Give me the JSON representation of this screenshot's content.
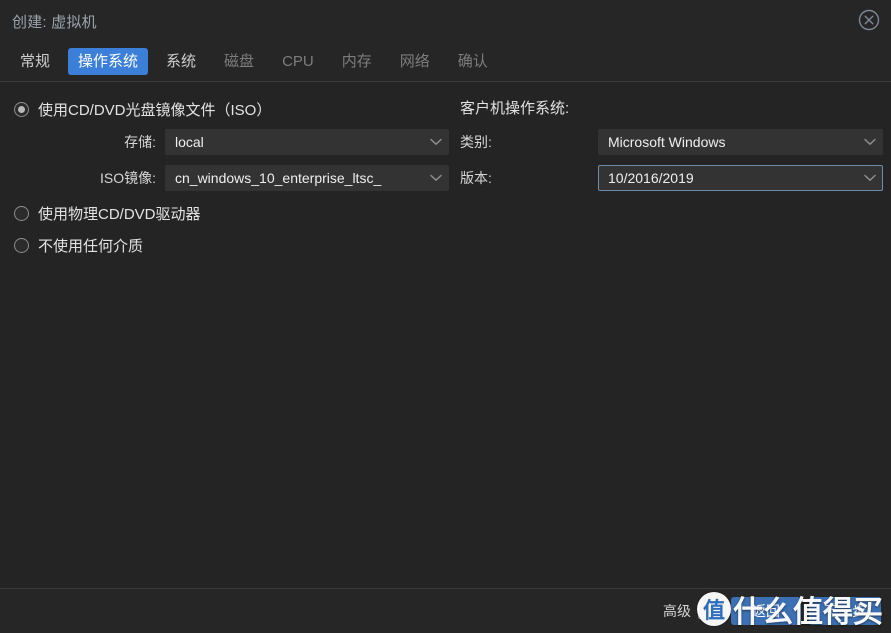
{
  "window": {
    "title": "创建: 虚拟机",
    "close_icon": "close-circle-icon"
  },
  "tabs": [
    {
      "label": "常规",
      "state": "normal"
    },
    {
      "label": "操作系统",
      "state": "active"
    },
    {
      "label": "系统",
      "state": "normal"
    },
    {
      "label": "磁盘",
      "state": "dim"
    },
    {
      "label": "CPU",
      "state": "dim"
    },
    {
      "label": "内存",
      "state": "dim"
    },
    {
      "label": "网络",
      "state": "dim"
    },
    {
      "label": "确认",
      "state": "dim"
    }
  ],
  "left": {
    "media_options": [
      {
        "label": "使用CD/DVD光盘镜像文件（ISO）",
        "selected": true
      },
      {
        "label": "使用物理CD/DVD驱动器",
        "selected": false
      },
      {
        "label": "不使用任何介质",
        "selected": false
      }
    ],
    "fields": [
      {
        "label": "存储:",
        "value": "local",
        "focused": false
      },
      {
        "label": "ISO镜像:",
        "value": "cn_windows_10_enterprise_ltsc_",
        "focused": false
      }
    ]
  },
  "right": {
    "section_title": "客户机操作系统:",
    "fields": [
      {
        "label": "类别:",
        "value": "Microsoft Windows",
        "focused": false
      },
      {
        "label": "版本:",
        "value": "10/2016/2019",
        "focused": true
      }
    ]
  },
  "footer": {
    "advanced_label": "高级",
    "advanced_checked": false,
    "buttons": [
      {
        "label": "返回"
      },
      {
        "label": "下一步"
      }
    ]
  },
  "watermark": {
    "badge": "值",
    "text": "什么值得买"
  },
  "colors": {
    "accent_blue": "#3c7fd8",
    "button_blue": "#3c6fb4",
    "background": "#242424",
    "chrome": "#262626",
    "field": "#333333",
    "focus_border": "#6e8cab",
    "title_text": "#9aa4ae"
  }
}
